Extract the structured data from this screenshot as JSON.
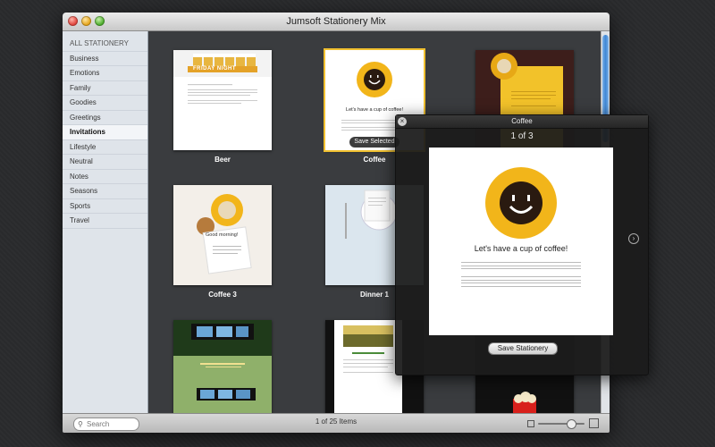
{
  "window": {
    "title": "Jumsoft Stationery Mix"
  },
  "sidebar": {
    "header": "ALL STATIONERY",
    "items": [
      {
        "label": "Business"
      },
      {
        "label": "Emotions"
      },
      {
        "label": "Family"
      },
      {
        "label": "Goodies"
      },
      {
        "label": "Greetings"
      },
      {
        "label": "Invitations",
        "selected": true
      },
      {
        "label": "Lifestyle"
      },
      {
        "label": "Neutral"
      },
      {
        "label": "Notes"
      },
      {
        "label": "Seasons"
      },
      {
        "label": "Sports"
      },
      {
        "label": "Travel"
      }
    ]
  },
  "grid": {
    "items": [
      {
        "label": "Beer",
        "preview_text": "FRIDAY NIGHT"
      },
      {
        "label": "Coffee",
        "preview_text": "Let's have a cup of coffee!",
        "selected": true
      },
      {
        "label": ""
      },
      {
        "label": "Coffee 3",
        "preview_text": "Good morning!"
      },
      {
        "label": "Dinner 1"
      },
      {
        "label": ""
      },
      {
        "label": ""
      },
      {
        "label": ""
      },
      {
        "label": ""
      }
    ],
    "save_selected": "Save Selected"
  },
  "bottom_bar": {
    "search_placeholder": "Search",
    "items_count": "1 of 25 Items"
  },
  "popup": {
    "title": "Coffee",
    "pager": "1 of 3",
    "page_text": "Let's have a cup of coffee!",
    "save_button": "Save Stationery"
  },
  "colors": {
    "accent_selected": "#f0c030",
    "coffee_yellow": "#f2b51a",
    "scroll_blue": "#3d86d6"
  },
  "icons": [
    "close-icon",
    "minimize-icon",
    "maximize-icon",
    "search-icon",
    "zoom-small-icon",
    "zoom-large-icon",
    "next-arrow-icon",
    "popup-close-icon",
    "coffee-cup-icon"
  ]
}
